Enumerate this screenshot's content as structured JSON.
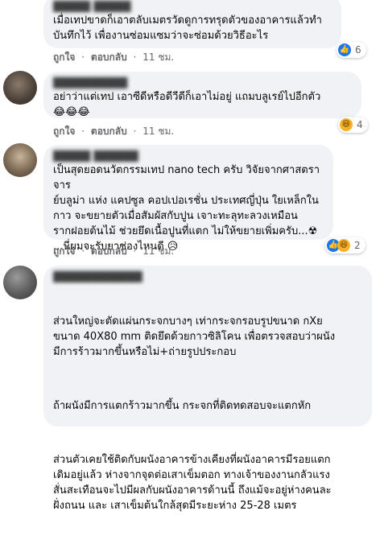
{
  "comments": [
    {
      "text": "เมื่อเทปขาดก็เอาตลับเมตรวัดดูการทรุดตัวของอาคารแล้วทำ\nบันทึกไว้ เพื่องานซ่อมแซมว่าจะซ่อมด้วยวิธีอะไร",
      "like_label": "ถูกใจ",
      "reply_label": "ตอบกลับ",
      "time": "11 ชม.",
      "reaction_icon": "like-icon",
      "reaction_count": "6"
    },
    {
      "text": "อย่าว่าแต่เทป เอาซีดีหรือดีวีดีก็เอาไม่อยู่ แถมบลูเรย์ไปอีกตัว",
      "emoji": "😂😂😂",
      "like_label": "ถูกใจ",
      "reply_label": "ตอบกลับ",
      "time": "11 ชม.",
      "reaction_icon": "haha-icon",
      "reaction_count": "4"
    },
    {
      "text": "เป็นสุดยอดนวัตกรรมเทป nano tech ครับ วิจัยจากศาสตราจาร\nย์บลูม่า แห่ง แคปซูล คอปเปอเรชั่น ประเทศญี่ปุ่น ใยเหล็กใน\nกาว จะขยายตัวเมื่อสัมผัสกับปูน เจาะทะลุทะลวงเหมือน\nรากฝอยต้นไม้ ช่วยยึดเนื้อปูนที่แตก ไม่ให้ขยายเพิ่มครับ...",
      "text_end": "...นี่ผมจะรับยาช่องไหนดี",
      "emoji_mid": "☢",
      "emoji_end": "😥",
      "like_label": "ถูกใจ",
      "reply_label": "ตอบกลับ",
      "time": "11 ชม.",
      "reaction_icons": [
        "like-icon",
        "haha-icon"
      ],
      "reaction_count": "2"
    },
    {
      "paragraphs": [
        "ส่วนใหญ่จะตัดแผ่นกระจกบางๆ เท่ากระจกรอบรูปขนาด กXย\nขนาด 40X80 mm ติดยึดด้วยกาวซิลิโคน เพื่อตรวจสอบว่าผนัง\nมีการร้าวมากขึ้นหรือไม่+ถ่ายรูปประกอบ",
        "ถ้าผนังมีการแตกร้าวมากขึ้น กระจกที่ติดทดสอบจะแตกหัก",
        "ส่วนตัวเคยใช้ติดกับผนังอาคารข้างเคียงที่ผนังอาคารมีรอยแตก\nเดิมอยู่แล้ว ห่างจากจุดต่อเสาเข็มตอก ทางเจ้าของงานกลัวแรง\nสั่นสะเทือนจะไปมีผลกับผนังอาคารด้านนี้ ถึงแม้จะอยู่ห่างคนละ\nฝั่งถนน และ เสาเข็มต้นใกล้สุดมีระยะห่าง 25-28 เมตร"
      ]
    }
  ]
}
